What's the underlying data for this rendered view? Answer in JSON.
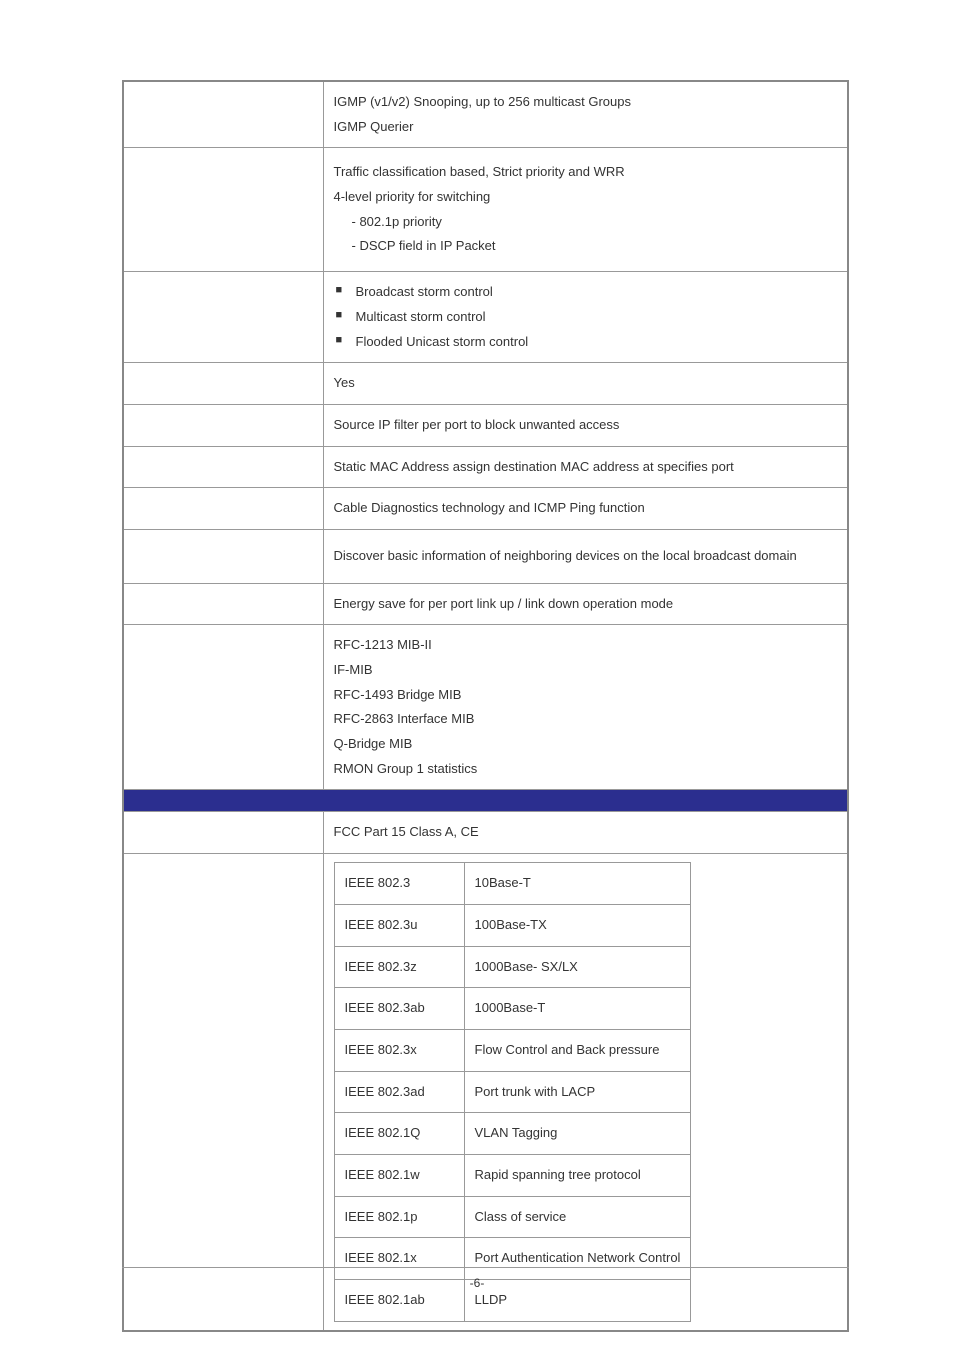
{
  "rows": {
    "igmp": {
      "l1": "IGMP (v1/v2) Snooping, up to 256 multicast Groups",
      "l2": "IGMP Querier"
    },
    "qos": {
      "l1": "Traffic classification based, Strict priority and WRR",
      "l2": "4-level priority for switching",
      "l3": "- 802.1p priority",
      "l4": "- DSCP field in IP Packet"
    },
    "storm": {
      "b1": "Broadcast storm control",
      "b2": "Multicast storm control",
      "b3": "Flooded Unicast storm control"
    },
    "yes": "Yes",
    "ipfilter": "Source IP filter per port to block unwanted access",
    "staticmac": "Static MAC Address assign destination MAC address at specifies port",
    "cable": "Cable Diagnostics technology and ICMP Ping function",
    "lldp": "Discover basic information of neighboring devices on the local broadcast domain",
    "energy": "Energy save for per port link up / link down operation mode",
    "mib": {
      "l1": "RFC-1213 MIB-II",
      "l2": "IF-MIB",
      "l3": "RFC-1493 Bridge MIB",
      "l4": "RFC-2863 Interface MIB",
      "l5": "Q-Bridge MIB",
      "l6": "RMON Group 1 statistics"
    },
    "section_header": "",
    "regulatory": "FCC Part 15 Class A, CE",
    "standards": [
      {
        "k": "IEEE 802.3",
        "v": "10Base-T"
      },
      {
        "k": "IEEE 802.3u",
        "v": "100Base-TX"
      },
      {
        "k": "IEEE 802.3z",
        "v": "1000Base- SX/LX"
      },
      {
        "k": "IEEE 802.3ab",
        "v": "1000Base-T"
      },
      {
        "k": "IEEE 802.3x",
        "v": "Flow Control and Back pressure"
      },
      {
        "k": "IEEE 802.3ad",
        "v": "Port trunk with LACP"
      },
      {
        "k": "IEEE 802.1Q",
        "v": "VLAN Tagging"
      },
      {
        "k": "IEEE 802.1w",
        "v": "Rapid spanning tree protocol"
      },
      {
        "k": "IEEE 802.1p",
        "v": "Class of service"
      },
      {
        "k": "IEEE 802.1x",
        "v": "Port Authentication Network Control"
      },
      {
        "k": "IEEE 802.1ab",
        "v": "LLDP"
      }
    ]
  },
  "footer": "-6-"
}
